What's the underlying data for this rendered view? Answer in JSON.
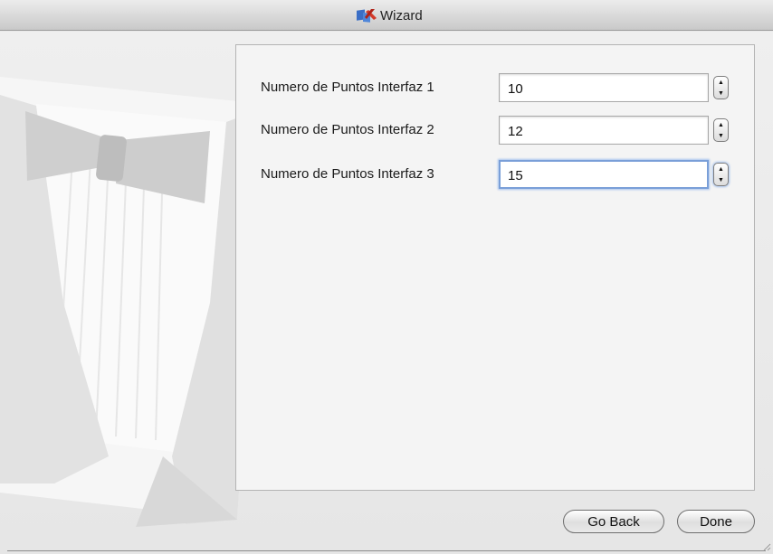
{
  "window": {
    "title": "Wizard",
    "app_icon": "wizard-app-icon"
  },
  "fields": [
    {
      "label": "Numero de Puntos Interfaz 1",
      "value": "10",
      "focused": false
    },
    {
      "label": "Numero de Puntos Interfaz 2",
      "value": "12",
      "focused": false
    },
    {
      "label": "Numero de Puntos Interfaz 3",
      "value": "15",
      "focused": true
    }
  ],
  "buttons": {
    "back_label": "Go Back",
    "done_label": "Done"
  },
  "colors": {
    "focus_ring": "#7a9fd8",
    "panel_bg": "#f4f4f4",
    "window_bg": "#e9e9e9"
  }
}
